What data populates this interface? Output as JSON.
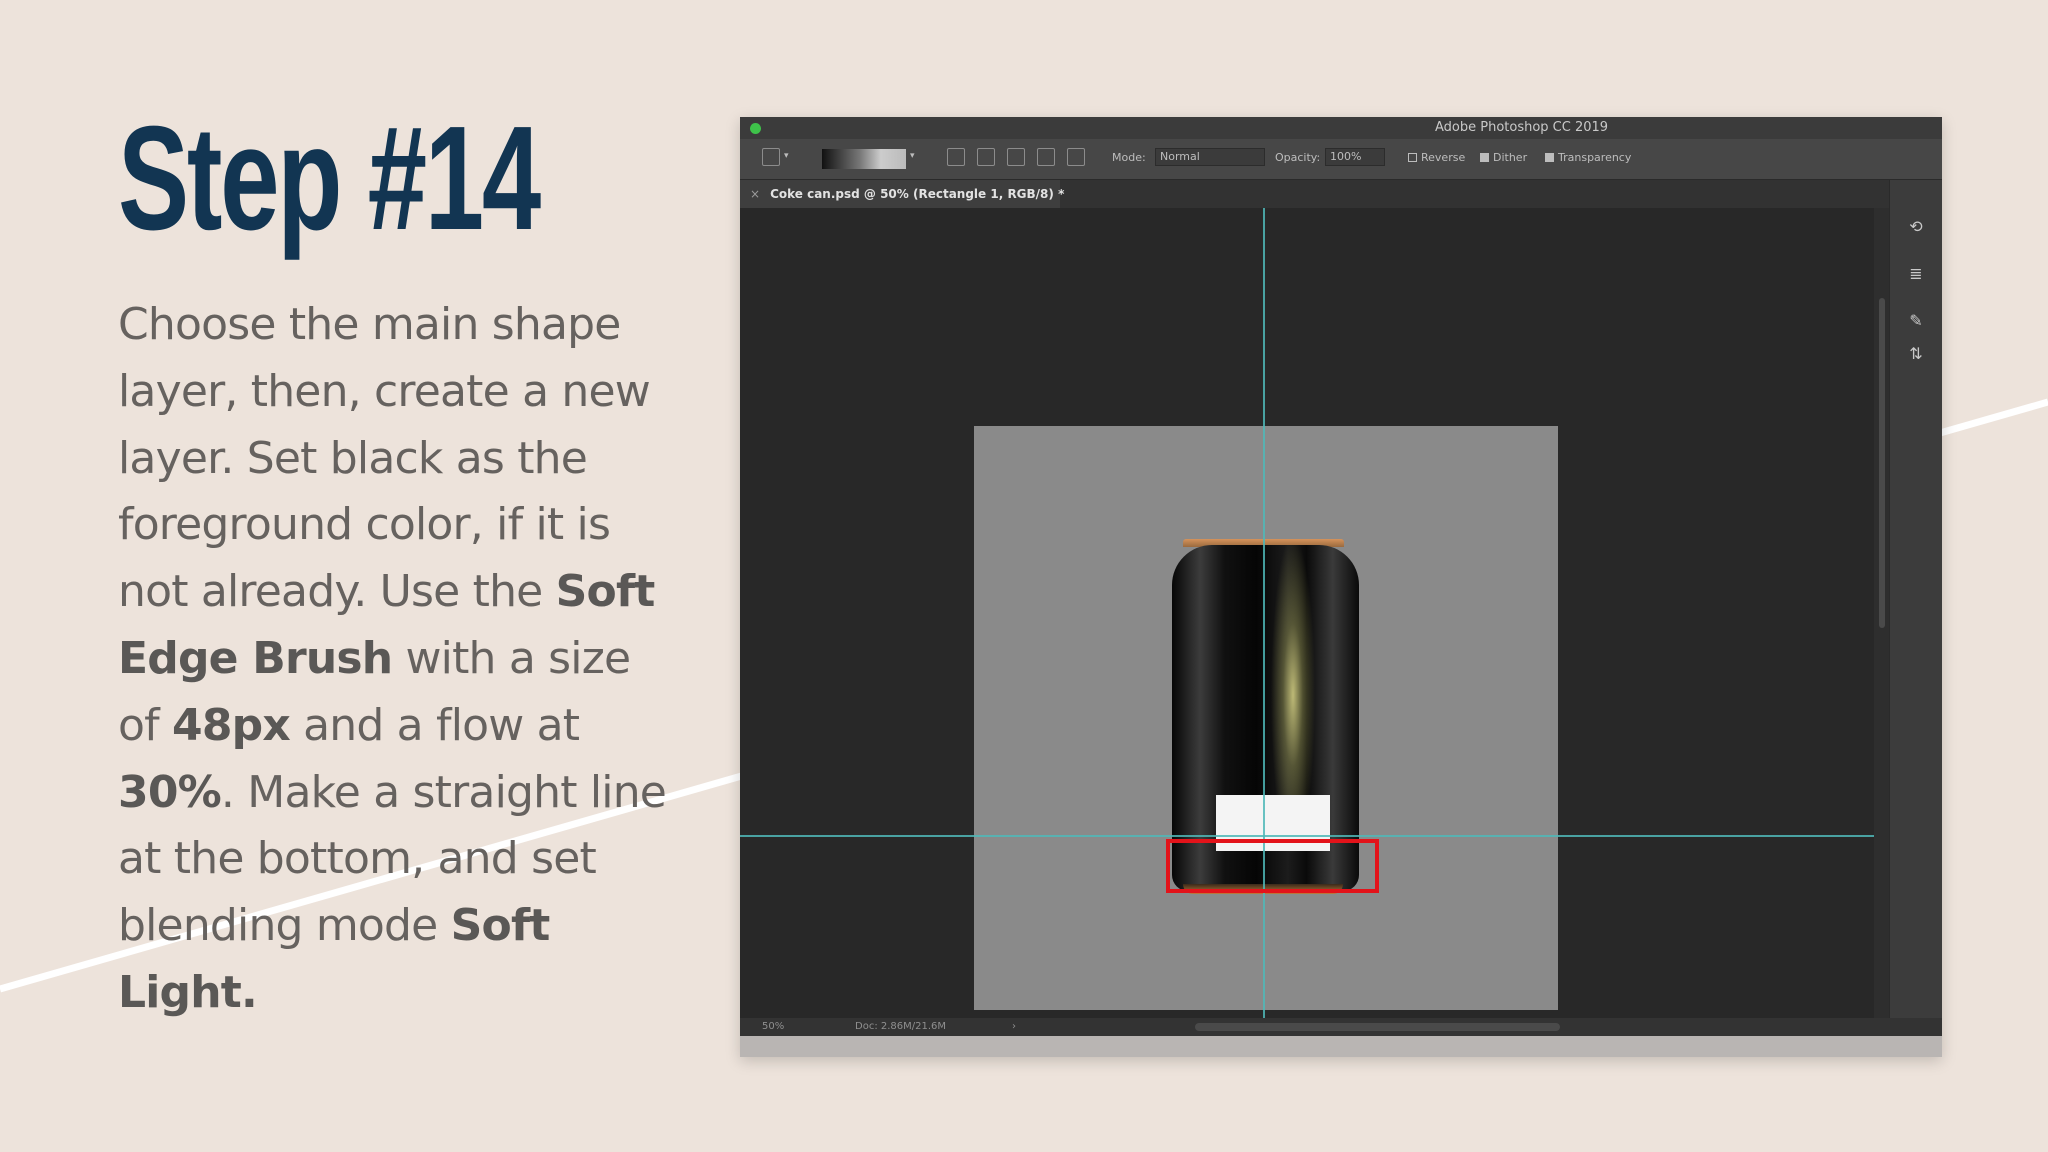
{
  "slide": {
    "title": "Step #14",
    "body": [
      {
        "text": "Choose the main shape layer, then, create a new layer. Set black as the foreground color, if it is not already. Use the ",
        "bold": false
      },
      {
        "text": "Soft Edge Brush",
        "bold": true
      },
      {
        "text": " with a size of ",
        "bold": false
      },
      {
        "text": "48px",
        "bold": true
      },
      {
        "text": " and a flow at ",
        "bold": false
      },
      {
        "text": "30%",
        "bold": true
      },
      {
        "text": ". Make a straight line at the bottom, and set blending mode ",
        "bold": false
      },
      {
        "text": "Soft Light.",
        "bold": true
      }
    ]
  },
  "photoshop": {
    "app_title": "Adobe Photoshop CC 2019",
    "options_bar": {
      "mode_label": "Mode:",
      "mode_value": "Normal",
      "opacity_label": "Opacity:",
      "opacity_value": "100%",
      "reverse_label": "Reverse",
      "dither_label": "Dither",
      "transparency_label": "Transparency"
    },
    "document_tab": "Coke can.psd @ 50% (Rectangle 1, RGB/8) *",
    "status_bar": {
      "zoom": "50%",
      "doc_info": "Doc: 2.86M/21.6M"
    },
    "colors": {
      "highlight": "#e3131a",
      "guides": "#4fb7b7",
      "title": "#123552",
      "background": "#ede3db"
    },
    "panel_icons": [
      "history-icon",
      "layers-icon",
      "brush-settings-icon",
      "adjustments-icon"
    ]
  }
}
